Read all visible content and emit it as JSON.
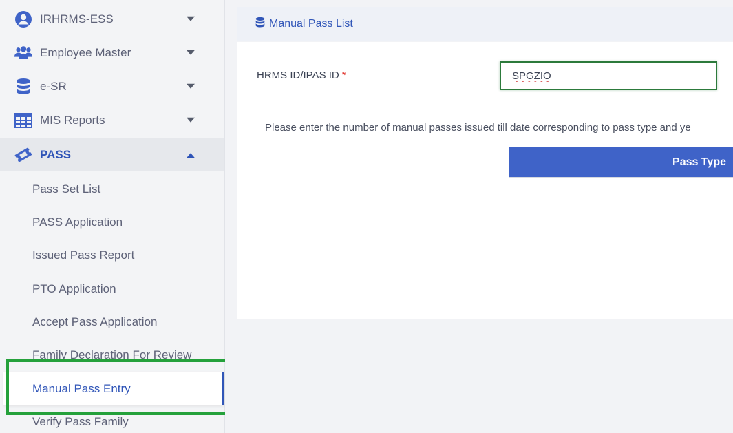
{
  "sidebar": {
    "items": [
      {
        "label": "IRHRMS-ESS",
        "icon": "user-circle-icon"
      },
      {
        "label": "Employee Master",
        "icon": "users-icon"
      },
      {
        "label": "e-SR",
        "icon": "database-icon"
      },
      {
        "label": "MIS Reports",
        "icon": "table-icon"
      },
      {
        "label": "PASS",
        "icon": "ticket-icon"
      }
    ],
    "pass_submenu": [
      "Pass Set List",
      "PASS Application",
      "Issued Pass Report",
      "PTO Application",
      "Accept Pass Application",
      "Family Declaration For Review",
      "Manual Pass Entry",
      "Verify Pass Family"
    ]
  },
  "header": {
    "breadcrumb": "Manual Pass List",
    "icon": "database-icon"
  },
  "form": {
    "id_label": "HRMS ID/IPAS ID",
    "required_mark": "*",
    "id_value": "SPGZIO",
    "instruction": "Please enter the number of manual passes issued till date corresponding to pass type and ye"
  },
  "table": {
    "header": "Pass Type"
  },
  "colors": {
    "accent": "#3156b8",
    "table_header": "#3f63c8",
    "highlight": "#25a13b",
    "required": "#e0342d"
  }
}
